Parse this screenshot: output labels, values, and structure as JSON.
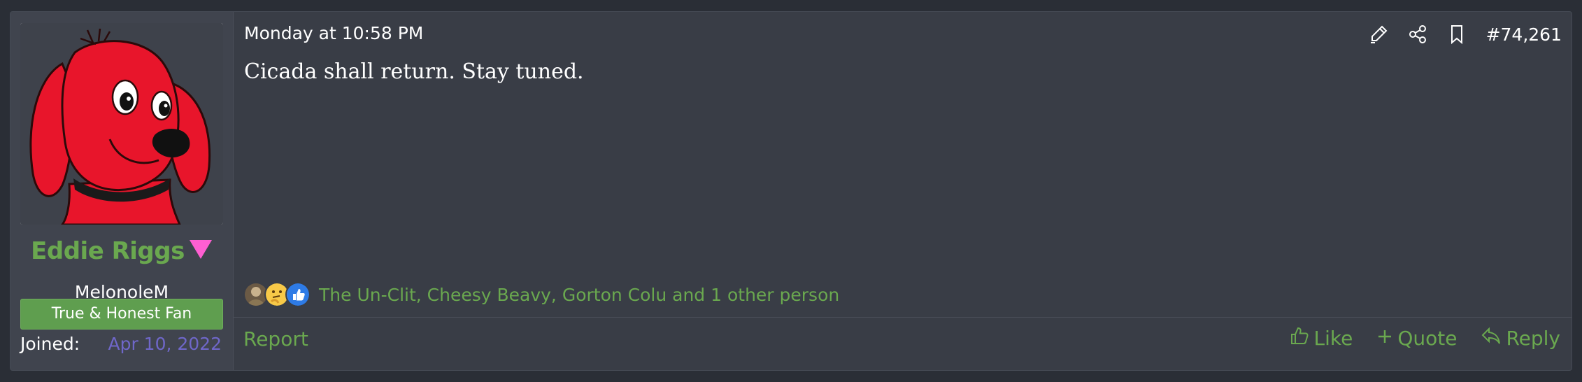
{
  "user": {
    "name": "Eddie Riggs",
    "title": "MelonoleM",
    "banner": "True & Honest Fan",
    "joined_label": "Joined:",
    "joined_date": "Apr 10, 2022",
    "avatar_icon": "clifford-avatar",
    "gender_icon": "pink-triangle-icon"
  },
  "post": {
    "date": "Monday at 10:58 PM",
    "number": "#74,261",
    "body": "Cicada shall return. Stay tuned."
  },
  "reactions": {
    "icons": [
      "reaction-avatar-icon",
      "thinking-emoji-icon",
      "thumbs-up-icon"
    ],
    "text": "The Un-Clit, Cheesy Beavy, Gorton Colu and 1 other person"
  },
  "footer": {
    "report": "Report",
    "like": "Like",
    "quote": "Quote",
    "reply": "Reply"
  },
  "colors": {
    "link_green": "#6aa84f",
    "banner_green": "#5f9e4f",
    "joined_purple": "#6f67c9",
    "gender_pink": "#ff5fd2",
    "background": "#393d46"
  }
}
